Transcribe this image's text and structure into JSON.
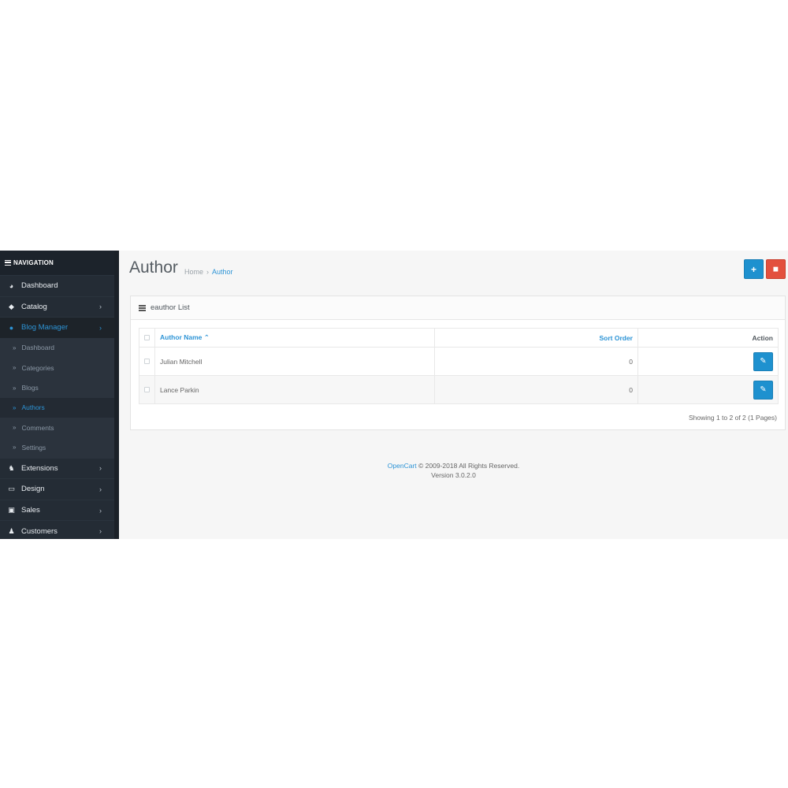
{
  "sidebar": {
    "title": "NAVIGATION",
    "items": [
      {
        "label": "Dashboard",
        "icon": "dashboard-icon"
      },
      {
        "label": "Catalog",
        "icon": "tags-icon"
      },
      {
        "label": "Blog Manager",
        "icon": "info-icon"
      },
      {
        "label": "Extensions",
        "icon": "puzzle-icon"
      },
      {
        "label": "Design",
        "icon": "monitor-icon"
      },
      {
        "label": "Sales",
        "icon": "cart-icon"
      },
      {
        "label": "Customers",
        "icon": "user-icon"
      }
    ],
    "sub_items": [
      {
        "label": "Dashboard"
      },
      {
        "label": "Categories"
      },
      {
        "label": "Blogs"
      },
      {
        "label": "Authors"
      },
      {
        "label": "Comments"
      },
      {
        "label": "Settings"
      }
    ]
  },
  "header": {
    "title": "Author",
    "breadcrumb": [
      "Home",
      "Author"
    ]
  },
  "panel": {
    "title": "eauthor List",
    "columns": {
      "name": "Author Name",
      "sort": "Sort Order",
      "action": "Action"
    },
    "rows": [
      {
        "name": "Julian Mitchell",
        "sort": "0"
      },
      {
        "name": "Lance Parkin",
        "sort": "0"
      }
    ],
    "pagination_text": "Showing 1 to 2 of 2 (1 Pages)"
  },
  "footer": {
    "link": "OpenCart",
    "rights": "© 2009-2018 All Rights Reserved.",
    "version": "Version 3.0.2.0"
  },
  "colors": {
    "accent": "#1e91cf",
    "danger": "#e3503e",
    "sidebar_bg": "#242c35"
  }
}
